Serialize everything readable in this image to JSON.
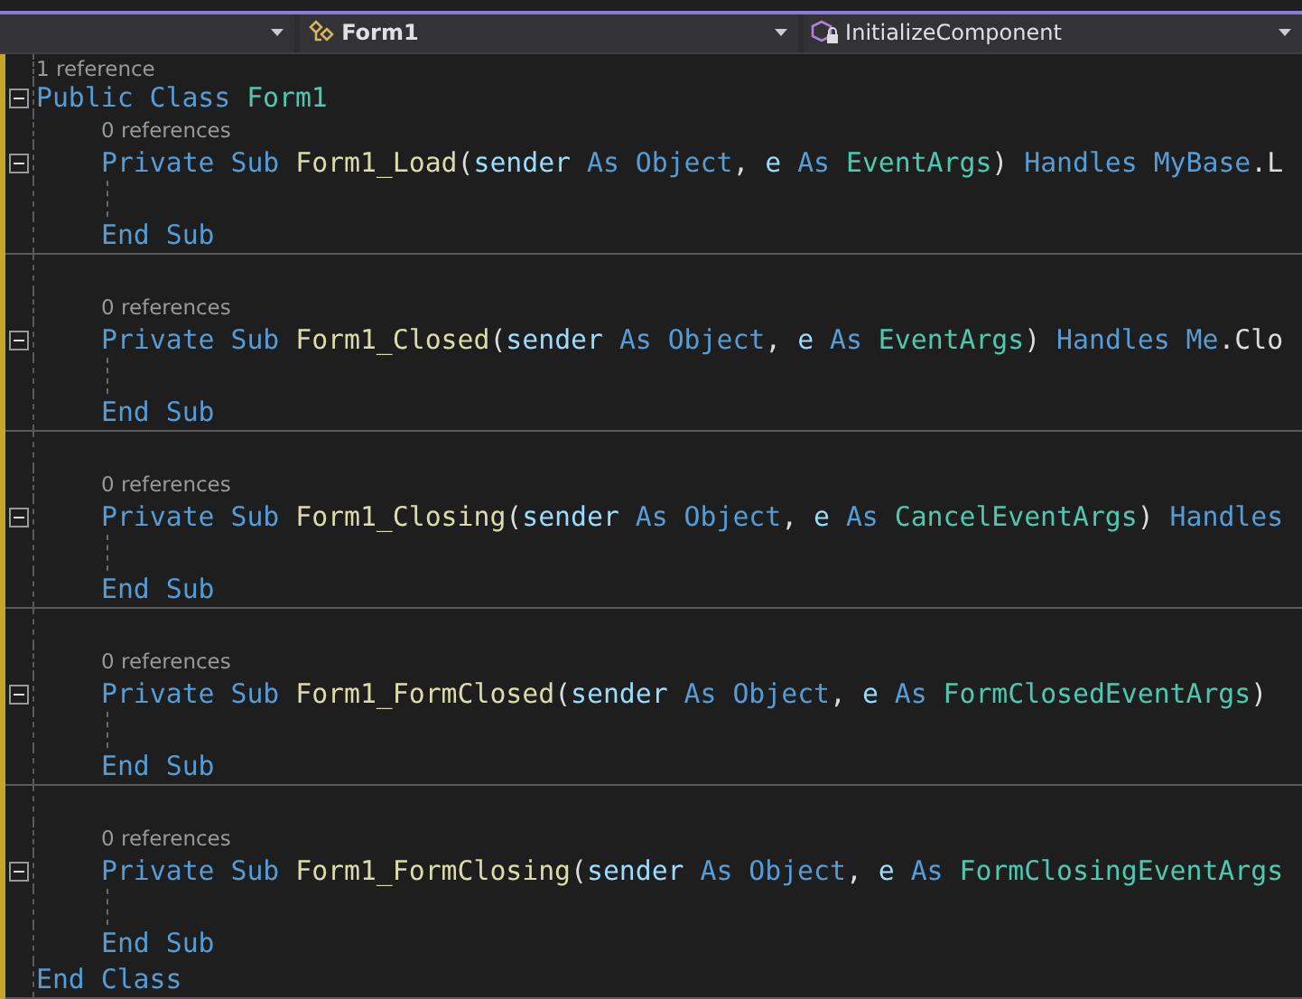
{
  "nav_bar": {
    "dropdowns": [
      {
        "kind": "empty"
      },
      {
        "kind": "class",
        "label": "Form1"
      },
      {
        "kind": "method",
        "label": "InitializeComponent"
      }
    ]
  },
  "editor": {
    "class_lens": "1 reference",
    "class_header": [
      {
        "kind": "keyword",
        "text": "Public "
      },
      {
        "kind": "keyword",
        "text": "Class "
      },
      {
        "kind": "type",
        "text": "Form1"
      }
    ],
    "members": [
      {
        "lens": "0 references",
        "header": [
          {
            "kind": "keyword",
            "text": "Private "
          },
          {
            "kind": "keyword",
            "text": "Sub "
          },
          {
            "kind": "method",
            "text": "Form1_Load"
          },
          {
            "kind": "plain",
            "text": "("
          },
          {
            "kind": "param",
            "text": "sender "
          },
          {
            "kind": "keyword",
            "text": "As "
          },
          {
            "kind": "keyword",
            "text": "Object"
          },
          {
            "kind": "plain",
            "text": ", "
          },
          {
            "kind": "param",
            "text": "e "
          },
          {
            "kind": "keyword",
            "text": "As "
          },
          {
            "kind": "type",
            "text": "EventArgs"
          },
          {
            "kind": "plain",
            "text": ") "
          },
          {
            "kind": "keyword",
            "text": "Handles "
          },
          {
            "kind": "keyword",
            "text": "MyBase"
          },
          {
            "kind": "plain",
            "text": ".L"
          }
        ],
        "end": [
          {
            "kind": "keyword",
            "text": "End "
          },
          {
            "kind": "keyword",
            "text": "Sub"
          }
        ]
      },
      {
        "lens": "0 references",
        "header": [
          {
            "kind": "keyword",
            "text": "Private "
          },
          {
            "kind": "keyword",
            "text": "Sub "
          },
          {
            "kind": "method",
            "text": "Form1_Closed"
          },
          {
            "kind": "plain",
            "text": "("
          },
          {
            "kind": "param",
            "text": "sender "
          },
          {
            "kind": "keyword",
            "text": "As "
          },
          {
            "kind": "keyword",
            "text": "Object"
          },
          {
            "kind": "plain",
            "text": ", "
          },
          {
            "kind": "param",
            "text": "e "
          },
          {
            "kind": "keyword",
            "text": "As "
          },
          {
            "kind": "type",
            "text": "EventArgs"
          },
          {
            "kind": "plain",
            "text": ") "
          },
          {
            "kind": "keyword",
            "text": "Handles "
          },
          {
            "kind": "keyword",
            "text": "Me"
          },
          {
            "kind": "plain",
            "text": ".Clo"
          }
        ],
        "end": [
          {
            "kind": "keyword",
            "text": "End "
          },
          {
            "kind": "keyword",
            "text": "Sub"
          }
        ]
      },
      {
        "lens": "0 references",
        "header": [
          {
            "kind": "keyword",
            "text": "Private "
          },
          {
            "kind": "keyword",
            "text": "Sub "
          },
          {
            "kind": "method",
            "text": "Form1_Closing"
          },
          {
            "kind": "plain",
            "text": "("
          },
          {
            "kind": "param",
            "text": "sender "
          },
          {
            "kind": "keyword",
            "text": "As "
          },
          {
            "kind": "keyword",
            "text": "Object"
          },
          {
            "kind": "plain",
            "text": ", "
          },
          {
            "kind": "param",
            "text": "e "
          },
          {
            "kind": "keyword",
            "text": "As "
          },
          {
            "kind": "type",
            "text": "CancelEventArgs"
          },
          {
            "kind": "plain",
            "text": ") "
          },
          {
            "kind": "keyword",
            "text": "Handles"
          }
        ],
        "end": [
          {
            "kind": "keyword",
            "text": "End "
          },
          {
            "kind": "keyword",
            "text": "Sub"
          }
        ]
      },
      {
        "lens": "0 references",
        "header": [
          {
            "kind": "keyword",
            "text": "Private "
          },
          {
            "kind": "keyword",
            "text": "Sub "
          },
          {
            "kind": "method",
            "text": "Form1_FormClosed"
          },
          {
            "kind": "plain",
            "text": "("
          },
          {
            "kind": "param",
            "text": "sender "
          },
          {
            "kind": "keyword",
            "text": "As "
          },
          {
            "kind": "keyword",
            "text": "Object"
          },
          {
            "kind": "plain",
            "text": ", "
          },
          {
            "kind": "param",
            "text": "e "
          },
          {
            "kind": "keyword",
            "text": "As "
          },
          {
            "kind": "type",
            "text": "FormClosedEventArgs"
          },
          {
            "kind": "plain",
            "text": ")"
          }
        ],
        "end": [
          {
            "kind": "keyword",
            "text": "End "
          },
          {
            "kind": "keyword",
            "text": "Sub"
          }
        ]
      },
      {
        "lens": "0 references",
        "header": [
          {
            "kind": "keyword",
            "text": "Private "
          },
          {
            "kind": "keyword",
            "text": "Sub "
          },
          {
            "kind": "method",
            "text": "Form1_FormClosing"
          },
          {
            "kind": "plain",
            "text": "("
          },
          {
            "kind": "param",
            "text": "sender "
          },
          {
            "kind": "keyword",
            "text": "As "
          },
          {
            "kind": "keyword",
            "text": "Object"
          },
          {
            "kind": "plain",
            "text": ", "
          },
          {
            "kind": "param",
            "text": "e "
          },
          {
            "kind": "keyword",
            "text": "As "
          },
          {
            "kind": "type",
            "text": "FormClosingEventArgs"
          }
        ],
        "end": [
          {
            "kind": "keyword",
            "text": "End "
          },
          {
            "kind": "keyword",
            "text": "Sub"
          }
        ]
      }
    ],
    "class_end": [
      {
        "kind": "keyword",
        "text": "End "
      },
      {
        "kind": "keyword",
        "text": "Class"
      }
    ]
  }
}
